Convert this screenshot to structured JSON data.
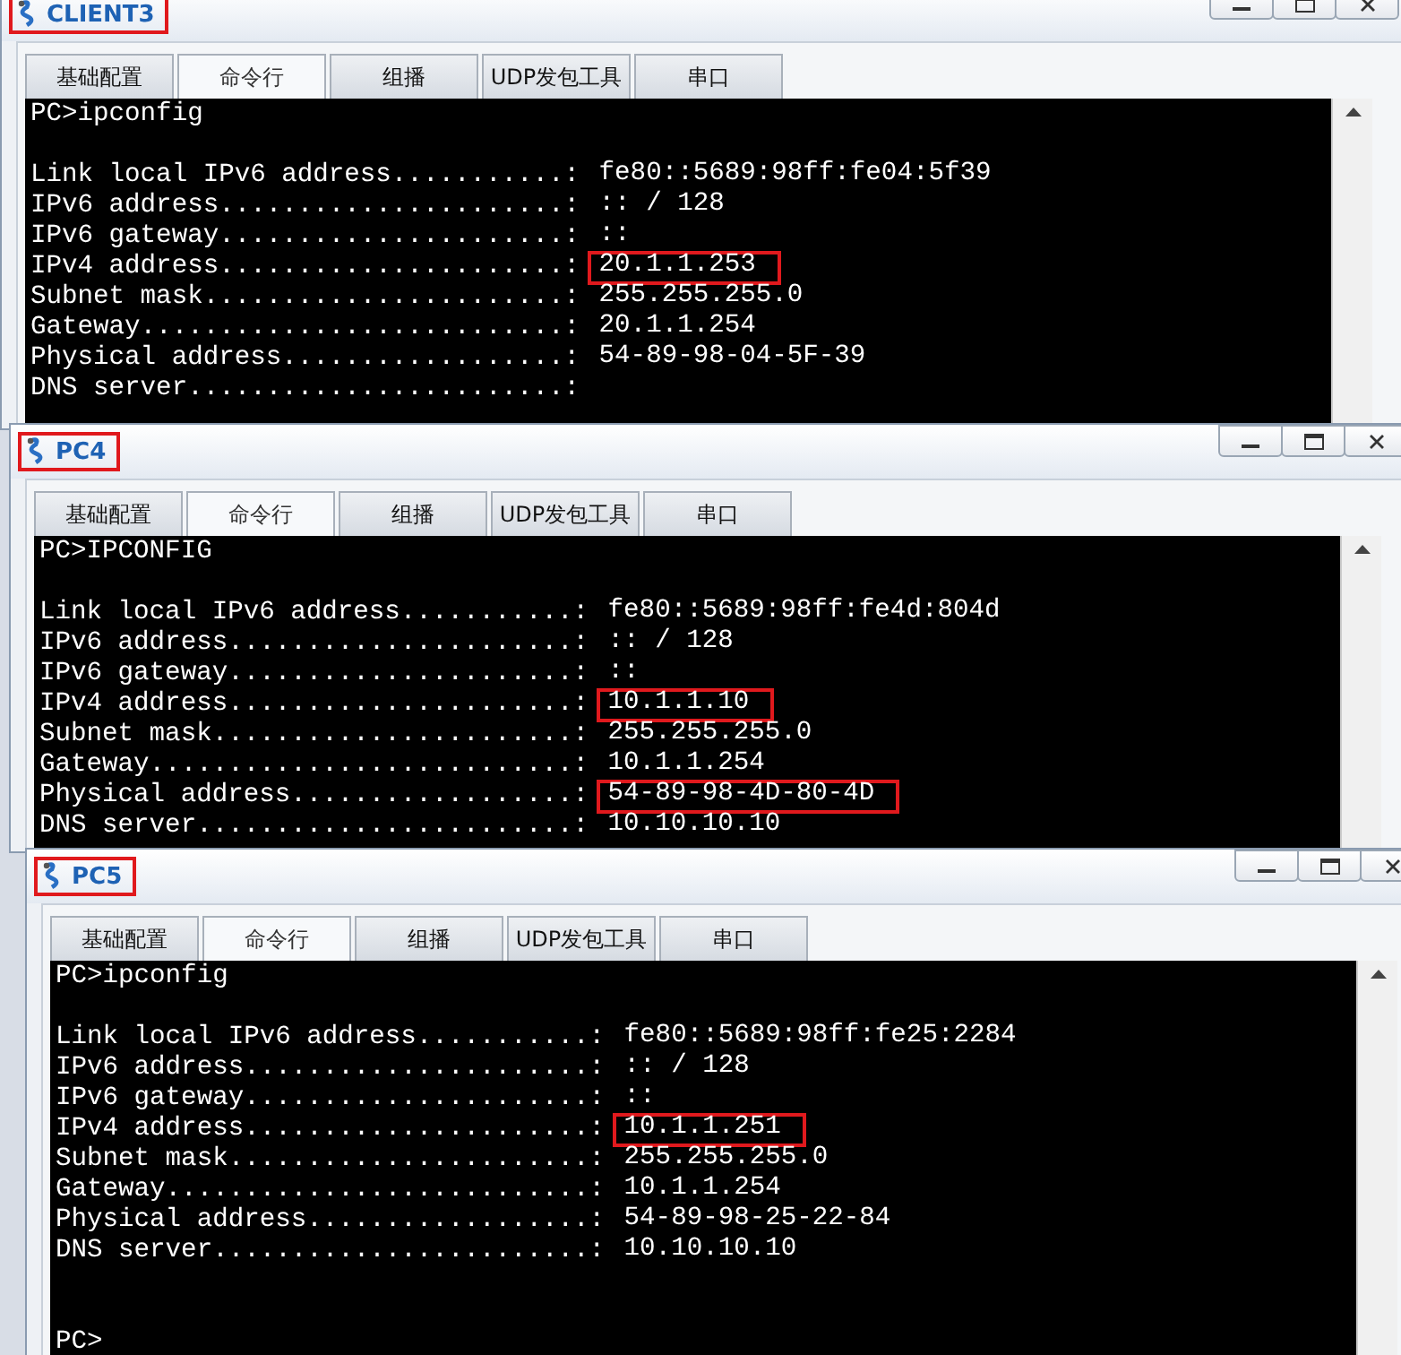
{
  "windows": [
    {
      "title": "CLIENT3",
      "title_highlighted": true,
      "tabs": [
        {
          "label": "基础配置",
          "selected": false
        },
        {
          "label": "命令行",
          "selected": true
        },
        {
          "label": "组播",
          "selected": false
        },
        {
          "label": "UDP发包工具",
          "selected": false
        },
        {
          "label": "串口",
          "selected": false
        }
      ],
      "console": {
        "lines": [
          {
            "kind": "command",
            "text": "PC>ipconfig"
          },
          {
            "kind": "blank"
          },
          {
            "kind": "field",
            "label": "Link local IPv6 address...........:",
            "value": "fe80::5689:98ff:fe04:5f39",
            "highlighted": false
          },
          {
            "kind": "field",
            "label": "IPv6 address......................:",
            "value": ":: / 128",
            "highlighted": false
          },
          {
            "kind": "field",
            "label": "IPv6 gateway......................:",
            "value": "::",
            "highlighted": false
          },
          {
            "kind": "field",
            "label": "IPv4 address......................:",
            "value": "20.1.1.253",
            "highlighted": true
          },
          {
            "kind": "field",
            "label": "Subnet mask.......................:",
            "value": "255.255.255.0",
            "highlighted": false
          },
          {
            "kind": "field",
            "label": "Gateway...........................:",
            "value": "20.1.1.254",
            "highlighted": false
          },
          {
            "kind": "field",
            "label": "Physical address..................:",
            "value": "54-89-98-04-5F-39",
            "highlighted": false
          },
          {
            "kind": "field",
            "label": "DNS server........................:",
            "highlighted": false
          }
        ]
      }
    },
    {
      "title": "PC4",
      "title_highlighted": true,
      "tabs": [
        {
          "label": "基础配置",
          "selected": false
        },
        {
          "label": "命令行",
          "selected": true
        },
        {
          "label": "组播",
          "selected": false
        },
        {
          "label": "UDP发包工具",
          "selected": false
        },
        {
          "label": "串口",
          "selected": false
        }
      ],
      "console": {
        "lines": [
          {
            "kind": "command",
            "text": "PC>IPCONFIG"
          },
          {
            "kind": "blank"
          },
          {
            "kind": "field",
            "label": "Link local IPv6 address...........:",
            "value": "fe80::5689:98ff:fe4d:804d",
            "highlighted": false
          },
          {
            "kind": "field",
            "label": "IPv6 address......................:",
            "value": ":: / 128",
            "highlighted": false
          },
          {
            "kind": "field",
            "label": "IPv6 gateway......................:",
            "value": "::",
            "highlighted": false
          },
          {
            "kind": "field",
            "label": "IPv4 address......................:",
            "value": "10.1.1.10",
            "highlighted": true
          },
          {
            "kind": "field",
            "label": "Subnet mask.......................:",
            "value": "255.255.255.0",
            "highlighted": false
          },
          {
            "kind": "field",
            "label": "Gateway...........................:",
            "value": "10.1.1.254",
            "highlighted": false
          },
          {
            "kind": "field",
            "label": "Physical address..................:",
            "value": "54-89-98-4D-80-4D",
            "highlighted": true
          },
          {
            "kind": "field",
            "label": "DNS server........................:",
            "value": "10.10.10.10",
            "highlighted": false
          }
        ]
      }
    },
    {
      "title": "PC5",
      "title_highlighted": true,
      "tabs": [
        {
          "label": "基础配置",
          "selected": false
        },
        {
          "label": "命令行",
          "selected": true
        },
        {
          "label": "组播",
          "selected": false
        },
        {
          "label": "UDP发包工具",
          "selected": false
        },
        {
          "label": "串口",
          "selected": false
        }
      ],
      "console": {
        "lines": [
          {
            "kind": "command",
            "text": "PC>ipconfig"
          },
          {
            "kind": "blank"
          },
          {
            "kind": "field",
            "label": "Link local IPv6 address...........:",
            "value": "fe80::5689:98ff:fe25:2284",
            "highlighted": false
          },
          {
            "kind": "field",
            "label": "IPv6 address......................:",
            "value": ":: / 128",
            "highlighted": false
          },
          {
            "kind": "field",
            "label": "IPv6 gateway......................:",
            "value": "::",
            "highlighted": false
          },
          {
            "kind": "field",
            "label": "IPv4 address......................:",
            "value": "10.1.1.251",
            "highlighted": true
          },
          {
            "kind": "field",
            "label": "Subnet mask.......................:",
            "value": "255.255.255.0",
            "highlighted": false
          },
          {
            "kind": "field",
            "label": "Gateway...........................:",
            "value": "10.1.1.254",
            "highlighted": false
          },
          {
            "kind": "field",
            "label": "Physical address..................:",
            "value": "54-89-98-25-22-84",
            "highlighted": false
          },
          {
            "kind": "field",
            "label": "DNS server........................:",
            "value": "10.10.10.10",
            "highlighted": false
          },
          {
            "kind": "blank"
          },
          {
            "kind": "blank"
          },
          {
            "kind": "command",
            "text": "PC>"
          }
        ]
      }
    }
  ]
}
